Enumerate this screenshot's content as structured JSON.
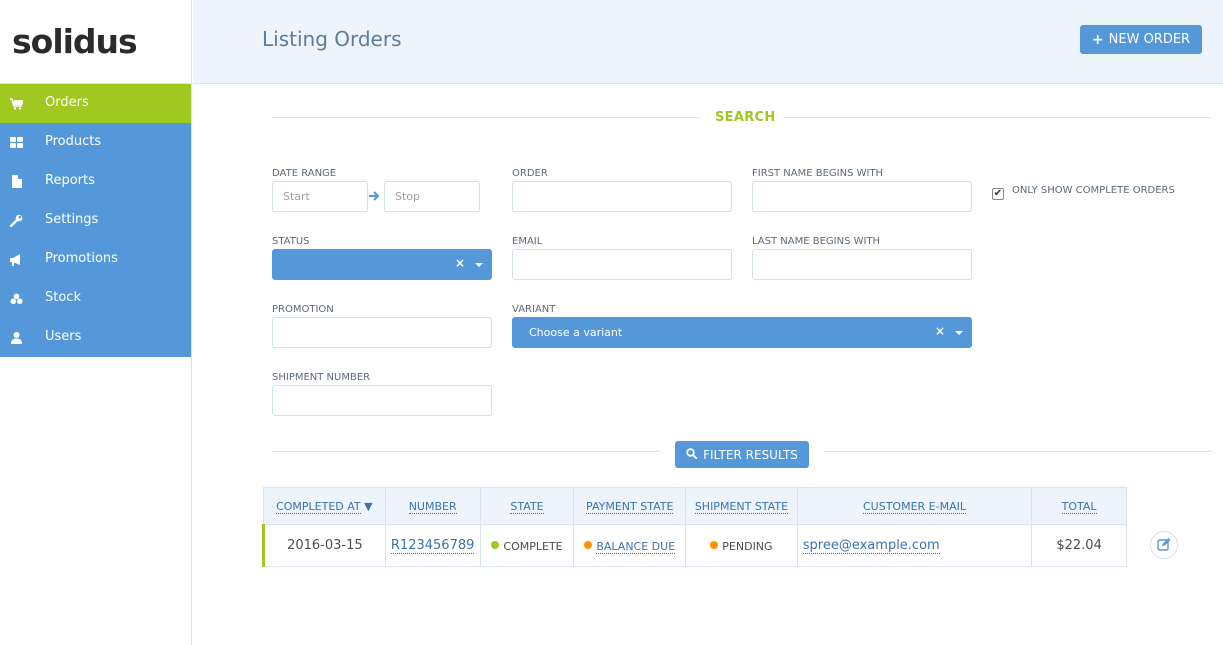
{
  "brand": {
    "logo_text": "solidus"
  },
  "sidebar": {
    "items": [
      {
        "label": "Orders",
        "icon": "cart-icon",
        "active": true
      },
      {
        "label": "Products",
        "icon": "grid-icon"
      },
      {
        "label": "Reports",
        "icon": "file-icon"
      },
      {
        "label": "Settings",
        "icon": "wrench-icon"
      },
      {
        "label": "Promotions",
        "icon": "bullhorn-icon"
      },
      {
        "label": "Stock",
        "icon": "cubes-icon"
      },
      {
        "label": "Users",
        "icon": "user-icon"
      }
    ]
  },
  "header": {
    "title": "Listing Orders",
    "new_order_label": "NEW ORDER"
  },
  "search": {
    "title": "SEARCH",
    "date_range_label": "DATE RANGE",
    "start_placeholder": "Start",
    "stop_placeholder": "Stop",
    "order_label": "ORDER",
    "first_name_label": "FIRST NAME BEGINS WITH",
    "only_complete_label": "ONLY SHOW COMPLETE ORDERS",
    "only_complete_checked": true,
    "status_label": "STATUS",
    "email_label": "EMAIL",
    "last_name_label": "LAST NAME BEGINS WITH",
    "promotion_label": "PROMOTION",
    "variant_label": "VARIANT",
    "variant_placeholder": "Choose a variant",
    "shipment_number_label": "SHIPMENT NUMBER",
    "filter_button_label": "FILTER RESULTS"
  },
  "orders_table": {
    "headers": {
      "completed_at": "COMPLETED AT",
      "number": "NUMBER",
      "state": "STATE",
      "payment_state": "PAYMENT STATE",
      "shipment_state": "SHIPMENT STATE",
      "customer_email": "CUSTOMER E-MAIL",
      "total": "TOTAL"
    },
    "sort_indicator": "▼",
    "rows": [
      {
        "completed_at": "2016-03-15",
        "number": "R123456789",
        "state": "COMPLETE",
        "payment_state": "BALANCE DUE",
        "shipment_state": "PENDING",
        "customer_email": "spree@example.com",
        "total": "$22.04"
      }
    ]
  },
  "colors": {
    "primary": "#5498da",
    "accent_green": "#9fc820",
    "warning_orange": "#ff9300",
    "header_bg": "#eef4fb"
  }
}
